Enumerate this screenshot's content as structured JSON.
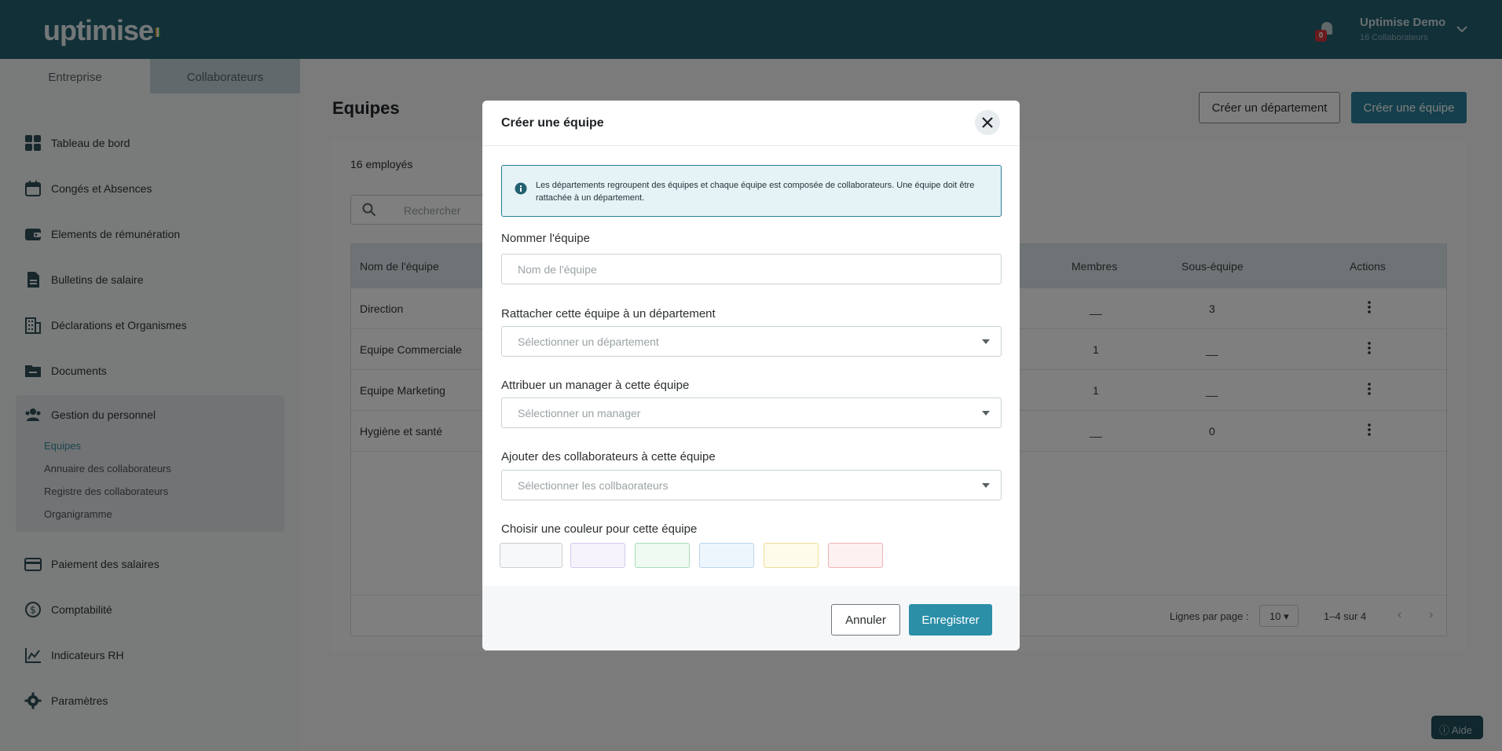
{
  "header": {
    "logo": "uptimise",
    "notifications_count": "0",
    "user_name": "Uptimise Demo",
    "user_sub": "16 Collaborateurs"
  },
  "sidebar": {
    "tabs": [
      {
        "label": "Entreprise",
        "active": false
      },
      {
        "label": "Collaborateurs",
        "active": true
      }
    ],
    "items": [
      {
        "label": "Tableau de bord",
        "icon": "dashboard-icon"
      },
      {
        "label": "Congés et Absences",
        "icon": "calendar-icon"
      },
      {
        "label": "Elements de rémunération",
        "icon": "wallet-icon"
      },
      {
        "label": "Bulletins de salaire",
        "icon": "payslip-icon"
      },
      {
        "label": "Déclarations et Organismes",
        "icon": "building-icon"
      },
      {
        "label": "Documents",
        "icon": "folder-icon"
      },
      {
        "label": "Gestion du personnel",
        "icon": "people-icon"
      },
      {
        "label": "Paiement des salaires",
        "icon": "card-icon"
      },
      {
        "label": "Comptabilité",
        "icon": "dollar-icon"
      },
      {
        "label": "Indicateurs RH",
        "icon": "chart-icon"
      },
      {
        "label": "Paramètres",
        "icon": "gear-icon"
      }
    ],
    "subitems": [
      {
        "label": "Equipes",
        "active": true
      },
      {
        "label": "Annuaire des collaborateurs",
        "active": false
      },
      {
        "label": "Registre des collaborateurs",
        "active": false
      },
      {
        "label": "Organigramme",
        "active": false
      }
    ]
  },
  "main": {
    "title": "Equipes",
    "create_department": "Créer un département",
    "create_team": "Créer une équipe",
    "count": "16 employés",
    "search_placeholder": "Rechercher",
    "columns": [
      "Nom de l'équipe",
      "Membres",
      "Sous-équipe",
      "Actions"
    ],
    "rows": [
      {
        "name": "Direction",
        "members": "__",
        "subteams": "3"
      },
      {
        "name": "Equipe Commerciale",
        "members": "1",
        "subteams": "__"
      },
      {
        "name": "Equipe Marketing",
        "members": "1",
        "subteams": "__"
      },
      {
        "name": "Hygiène et santé",
        "members": "__",
        "subteams": "0"
      }
    ],
    "rows_per_page_label": "Lignes par page :",
    "rows_per_page": "10",
    "range": "1–4 sur 4"
  },
  "modal": {
    "title": "Créer une équipe",
    "info": "Les départements regroupent des équipes et chaque équipe est composée de collaborateurs. Une équipe doit être rattachée à un département.",
    "name_label": "Nommer l'équipe",
    "name_placeholder": "Nom de l'équipe",
    "department_label": "Rattacher cette équipe à un département",
    "department_placeholder": "Sélectionner un département",
    "manager_label": "Attribuer un manager à cette équipe",
    "manager_placeholder": "Sélectionner un manager",
    "collaborators_label": "Ajouter des collaborateurs à cette équipe",
    "collaborators_placeholder": "Sélectionner les collbaorateurs",
    "color_label": "Choisir une couleur pour cette équipe",
    "colors": [
      {
        "fill": "#f7f8f9",
        "border": "#c9ced1"
      },
      {
        "fill": "#f7f3fd",
        "border": "#d6c9ef"
      },
      {
        "fill": "#eefaf2",
        "border": "#a8dbb8"
      },
      {
        "fill": "#eef6fd",
        "border": "#b8d4ee"
      },
      {
        "fill": "#fefbea",
        "border": "#f0dc9a"
      },
      {
        "fill": "#fef1f1",
        "border": "#f0b3b3"
      }
    ],
    "cancel": "Annuler",
    "save": "Enregistrer"
  },
  "help": "Aide"
}
